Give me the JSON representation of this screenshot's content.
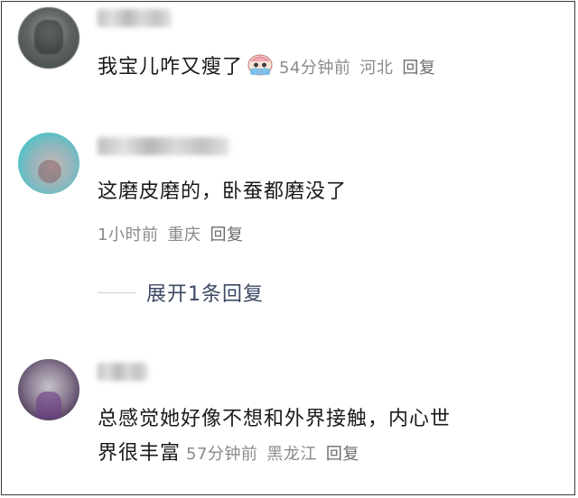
{
  "comments": [
    {
      "text": "我宝儿咋又瘦了",
      "emoji": "crying-face-emoji",
      "time": "54分钟前",
      "location": "河北",
      "reply_label": "回复"
    },
    {
      "text": "这磨皮磨的，卧蚕都磨没了",
      "time": "1小时前",
      "location": "重庆",
      "reply_label": "回复",
      "expand_label": "展开1条回复"
    },
    {
      "text_line1": "总感觉她好像不想和外界接触，内心世",
      "text_line2": "界很丰富",
      "time": "57分钟前",
      "location": "黑龙江",
      "reply_label": "回复"
    }
  ]
}
